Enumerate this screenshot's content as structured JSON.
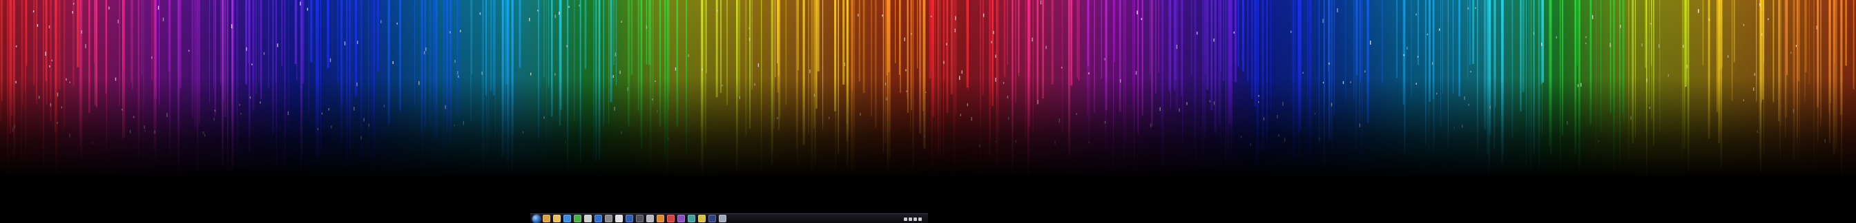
{
  "desktop": {
    "background_color": "#000000",
    "wallpaper_palette": [
      "#ff2a3a",
      "#ff2a8a",
      "#c020e0",
      "#6a20e8",
      "#1a30ff",
      "#1060ff",
      "#10b0ff",
      "#20d8f0",
      "#30e040",
      "#d8f020",
      "#ffd020",
      "#ff9020",
      "#ff5020"
    ]
  },
  "taskbar": {
    "background": "#111116",
    "start_button": {
      "icon": "windows-orb-icon"
    },
    "pinned_icons": [
      {
        "icon": "file-explorer-icon",
        "color": "#d9a440"
      },
      {
        "icon": "folder-icon",
        "color": "#e8c060"
      },
      {
        "icon": "internet-explorer-icon",
        "color": "#3a8ee0"
      },
      {
        "icon": "app-icon-green",
        "color": "#4ab04a"
      },
      {
        "icon": "notepad-icon",
        "color": "#d0d0d0"
      },
      {
        "icon": "media-player-icon",
        "color": "#3070d0"
      },
      {
        "icon": "app-icon-gray",
        "color": "#8a8a8a"
      },
      {
        "icon": "app-icon-white",
        "color": "#e0e0e0"
      },
      {
        "icon": "app-icon-blue",
        "color": "#2e5fb0"
      },
      {
        "icon": "app-icon-dark",
        "color": "#505058"
      },
      {
        "icon": "app-icon-light",
        "color": "#b8b8c0"
      },
      {
        "icon": "app-icon-orange",
        "color": "#e08a30"
      },
      {
        "icon": "app-icon-red",
        "color": "#d84040"
      },
      {
        "icon": "app-icon-purple",
        "color": "#8a50c0"
      },
      {
        "icon": "app-icon-teal",
        "color": "#40a0a0"
      },
      {
        "icon": "app-icon-yellow",
        "color": "#d8c040"
      },
      {
        "icon": "app-icon-navy",
        "color": "#304080"
      },
      {
        "icon": "app-icon-silver",
        "color": "#a0a8b8"
      }
    ],
    "tray": {
      "icons": [
        "tray-arrow-icon",
        "network-icon",
        "volume-icon",
        "flag-icon"
      ],
      "clock": {
        "time": "",
        "date": ""
      }
    }
  }
}
